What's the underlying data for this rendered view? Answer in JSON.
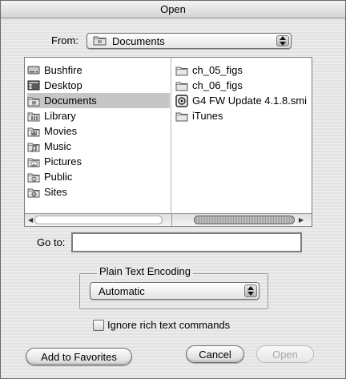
{
  "window": {
    "title": "Open"
  },
  "from": {
    "label": "From:",
    "value": "Documents"
  },
  "browser": {
    "column1": [
      {
        "label": "Bushfire",
        "icon": "hard-drive-icon",
        "selected": false
      },
      {
        "label": "Desktop",
        "icon": "desktop-icon",
        "selected": false
      },
      {
        "label": "Documents",
        "icon": "documents-folder-icon",
        "selected": true
      },
      {
        "label": "Library",
        "icon": "library-folder-icon",
        "selected": false
      },
      {
        "label": "Movies",
        "icon": "movies-folder-icon",
        "selected": false
      },
      {
        "label": "Music",
        "icon": "music-folder-icon",
        "selected": false
      },
      {
        "label": "Pictures",
        "icon": "pictures-folder-icon",
        "selected": false
      },
      {
        "label": "Public",
        "icon": "public-folder-icon",
        "selected": false
      },
      {
        "label": "Sites",
        "icon": "sites-folder-icon",
        "selected": false
      }
    ],
    "column2": [
      {
        "label": "ch_05_figs",
        "icon": "folder-icon"
      },
      {
        "label": "ch_06_figs",
        "icon": "folder-icon"
      },
      {
        "label": "G4 FW Update 4.1.8.smi",
        "icon": "disk-image-icon"
      },
      {
        "label": "iTunes",
        "icon": "folder-icon"
      }
    ]
  },
  "goto": {
    "label": "Go to:",
    "value": ""
  },
  "encoding": {
    "group_label": "Plain Text Encoding",
    "value": "Automatic"
  },
  "ignore_rich": {
    "label": "Ignore rich text commands",
    "checked": false
  },
  "buttons": {
    "add_favorites": "Add to Favorites",
    "cancel": "Cancel",
    "open": "Open"
  }
}
